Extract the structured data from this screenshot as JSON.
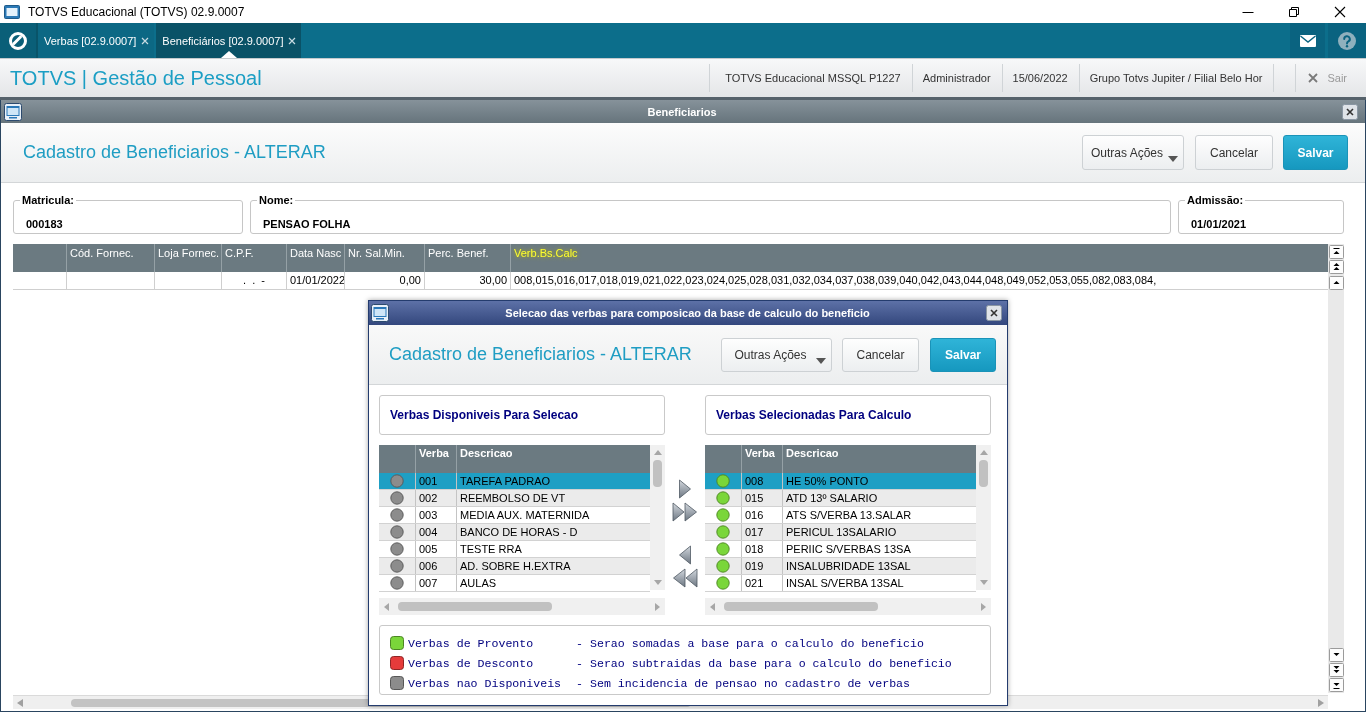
{
  "window": {
    "title": "TOTVS Educacional (TOTVS) 02.9.0007"
  },
  "tabs": [
    {
      "label": "Verbas [02.9.0007]",
      "selected": false
    },
    {
      "label": "Beneficiários [02.9.0007]",
      "selected": true
    }
  ],
  "header": {
    "title": "TOTVS | Gestão de Pessoal",
    "info": [
      "TOTVS Educacional MSSQL P1227",
      "Administrador",
      "15/06/2022",
      "Grupo Totvs Jupiter / Filial Belo Hor"
    ],
    "exit_label": "Sair"
  },
  "form_window": {
    "title": "Beneficiarios",
    "heading": "Cadastro de Beneficiarios - ALTERAR",
    "buttons": [
      {
        "label": "Outras Ações",
        "kind": "dropdown"
      },
      {
        "label": "Cancelar",
        "kind": "plain"
      },
      {
        "label": "Salvar",
        "kind": "primary"
      }
    ],
    "fields": [
      {
        "label": "Matricula:",
        "value": "000183"
      },
      {
        "label": "Nome:",
        "value": "PENSAO FOLHA"
      },
      {
        "label": "Admissão:",
        "value": "01/01/2021"
      }
    ],
    "table": {
      "columns": [
        {
          "label": "Cód. Fornec.",
          "selected": false
        },
        {
          "label": "Loja Fornec.",
          "selected": false
        },
        {
          "label": "C.P.F.",
          "selected": false
        },
        {
          "label": "Data Nasc",
          "selected": false
        },
        {
          "label": "Nr. Sal.Min.",
          "selected": false
        },
        {
          "label": "Perc. Benef.",
          "selected": false
        },
        {
          "label": "Verb.Bs.Calc",
          "selected": true
        }
      ],
      "rows": [
        {
          "cells": [
            null,
            null,
            ".  .  -",
            "01/01/2022",
            "0,00",
            "30,00",
            "008,015,016,017,018,019,021,022,023,024,025,028,031,032,034,037,038,039,040,042,043,044,048,049,052,053,055,082,083,084,"
          ]
        }
      ]
    }
  },
  "dialog": {
    "title": "Selecao das verbas para composicao da base de calculo do beneficio",
    "heading": "Cadastro de Beneficiarios - ALTERAR",
    "buttons": [
      {
        "label": "Outras Ações",
        "kind": "dropdown"
      },
      {
        "label": "Cancelar",
        "kind": "plain"
      },
      {
        "label": "Salvar",
        "kind": "primary"
      }
    ],
    "lists": [
      {
        "title": "Verbas Disponiveis Para Selecao",
        "columns": [
          "Verba",
          "Descricao"
        ],
        "rows": [
          {
            "code": "001",
            "description": "TAREFA PADRAO",
            "color": "#8c8c8c",
            "selected": true
          },
          {
            "code": "002",
            "description": "REEMBOLSO DE VT",
            "color": "#8c8c8c",
            "selected": false
          },
          {
            "code": "003",
            "description": "MEDIA AUX. MATERNIDA",
            "color": "#8c8c8c",
            "selected": false
          },
          {
            "code": "004",
            "description": "BANCO DE HORAS - D",
            "color": "#8c8c8c",
            "selected": false
          },
          {
            "code": "005",
            "description": "TESTE RRA",
            "color": "#8c8c8c",
            "selected": false
          },
          {
            "code": "006",
            "description": "AD. SOBRE H.EXTRA",
            "color": "#8c8c8c",
            "selected": false
          },
          {
            "code": "007",
            "description": "AULAS",
            "color": "#8c8c8c",
            "selected": false
          }
        ]
      },
      {
        "title": "Verbas Selecionadas Para Calculo",
        "columns": [
          "Verba",
          "Descricao"
        ],
        "rows": [
          {
            "code": "008",
            "description": "HE 50% PONTO",
            "color": "#7ad63a",
            "selected": true
          },
          {
            "code": "015",
            "description": "ATD 13º SALARIO",
            "color": "#7ad63a",
            "selected": false
          },
          {
            "code": "016",
            "description": "ATS S/VERBA 13.SALAR",
            "color": "#7ad63a",
            "selected": false
          },
          {
            "code": "017",
            "description": "PERICUL 13SALARIO",
            "color": "#7ad63a",
            "selected": false
          },
          {
            "code": "018",
            "description": "PERIIC S/VERBAS 13SA",
            "color": "#7ad63a",
            "selected": false
          },
          {
            "code": "019",
            "description": "INSALUBRIDADE 13SAL",
            "color": "#7ad63a",
            "selected": false
          },
          {
            "code": "021",
            "description": "INSAL S/VERBA 13SAL",
            "color": "#7ad63a",
            "selected": false
          }
        ]
      }
    ],
    "legend": [
      {
        "color": "#7ad63a",
        "label": "Verbas de Provento",
        "description": "- Serao somadas a base para o calculo do beneficio"
      },
      {
        "color": "#e53b3b",
        "label": "Verbas de Desconto",
        "description": "- Serao subtraidas da base para o calculo do beneficio"
      },
      {
        "color": "#8c8c8c",
        "label": "Verbas nao Disponiveis",
        "description": "- Sem incidencia de pensao no cadastro de verbas"
      }
    ]
  }
}
